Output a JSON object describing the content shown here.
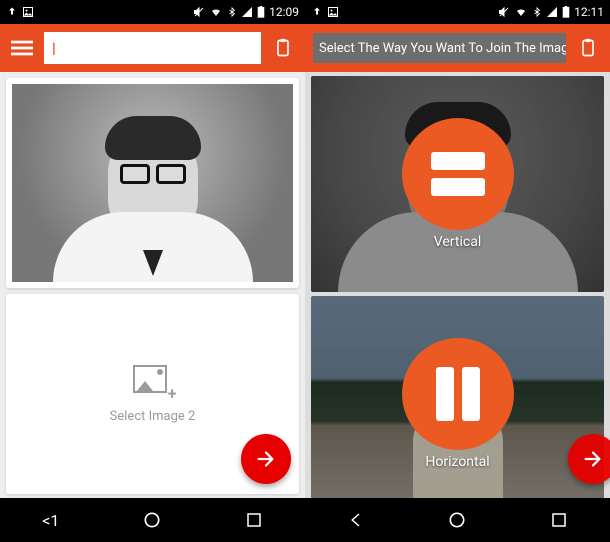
{
  "left": {
    "status": {
      "time": "12:09",
      "icons": [
        "upload-icon",
        "image-icon",
        "mute-icon",
        "wifi-icon",
        "bluetooth-icon",
        "signal-icon",
        "battery-icon"
      ]
    },
    "appbar": {
      "search_value": "",
      "search_cursor": "|"
    },
    "image1_alt": "Black and white portrait photo of a man with glasses",
    "placeholder_label": "Select Image 2",
    "nav_counter": "<1"
  },
  "right": {
    "status": {
      "time": "12:11",
      "icons": [
        "upload-icon",
        "image-icon",
        "mute-icon",
        "wifi-icon",
        "bluetooth-icon",
        "signal-icon",
        "battery-icon"
      ]
    },
    "tooltip_text": "Select The Way You Want To Join The Image",
    "options": {
      "vertical_label": "Vertical",
      "horizontal_label": "Horizontal"
    }
  }
}
